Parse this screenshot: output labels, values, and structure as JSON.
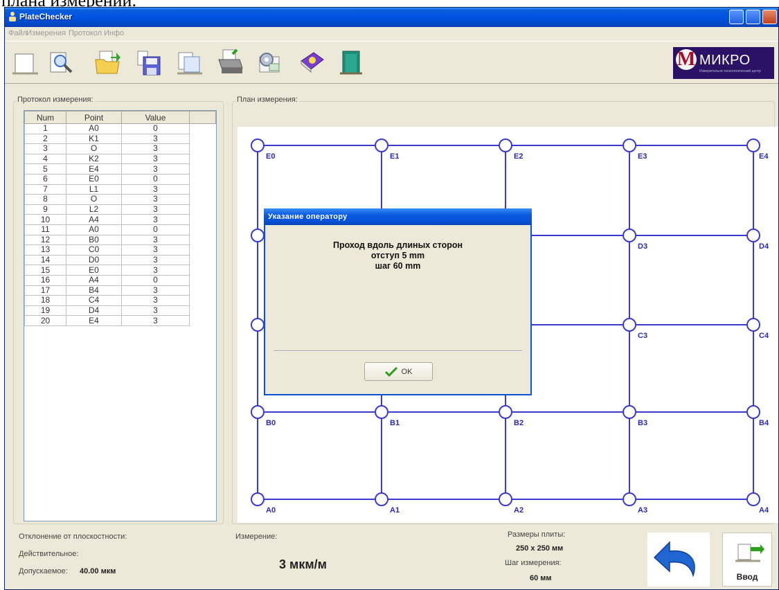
{
  "caption": "плана измерений.",
  "window": {
    "title": "PlateChecker"
  },
  "menu": [
    "Файл",
    "Измерения",
    "Протокол",
    "Инфо"
  ],
  "toolbar": {
    "icons": [
      "new-doc-icon",
      "preview-icon",
      "open-folder-icon",
      "save-icon",
      "copy-icon",
      "print-icon",
      "settings-icon",
      "help-book-icon",
      "exit-door-icon"
    ],
    "logo_brand": "МИКРО",
    "logo_mark": "М",
    "logo_sub": "Измерительно-технологический центр"
  },
  "protocol": {
    "label": "Протокол измерения:",
    "columns": [
      "Num",
      "Point",
      "Value"
    ],
    "rows": [
      [
        "1",
        "A0",
        "0"
      ],
      [
        "2",
        "K1",
        "3"
      ],
      [
        "3",
        "O",
        "3"
      ],
      [
        "4",
        "K2",
        "3"
      ],
      [
        "5",
        "E4",
        "3"
      ],
      [
        "6",
        "E0",
        "0"
      ],
      [
        "7",
        "L1",
        "3"
      ],
      [
        "8",
        "O",
        "3"
      ],
      [
        "9",
        "L2",
        "3"
      ],
      [
        "10",
        "A4",
        "3"
      ],
      [
        "11",
        "A0",
        "0"
      ],
      [
        "12",
        "B0",
        "3"
      ],
      [
        "13",
        "C0",
        "3"
      ],
      [
        "14",
        "D0",
        "3"
      ],
      [
        "15",
        "E0",
        "3"
      ],
      [
        "16",
        "A4",
        "0"
      ],
      [
        "17",
        "B4",
        "3"
      ],
      [
        "18",
        "C4",
        "3"
      ],
      [
        "19",
        "D4",
        "3"
      ],
      [
        "20",
        "E4",
        "3"
      ]
    ]
  },
  "plan": {
    "label": "План измерения:",
    "rows": [
      "E",
      "D",
      "C",
      "B",
      "A"
    ],
    "cols": [
      "0",
      "1",
      "2",
      "3",
      "4"
    ],
    "visible_labels": [
      "E0",
      "E1",
      "E2",
      "E3",
      "E4",
      "D3",
      "D4",
      "C3",
      "C4",
      "B0",
      "B1",
      "B2",
      "B3",
      "B4",
      "A0",
      "A1",
      "A2",
      "A3",
      "A4"
    ]
  },
  "deviation": {
    "title": "Отклонение от плоскостности:",
    "actual_label": "Действительное:",
    "allowed_label": "Допускаемое:",
    "allowed_value": "40.00 мкм"
  },
  "measurement": {
    "label": "Измерение:",
    "value": "3 мкм/м"
  },
  "plate": {
    "size_label": "Размеры плиты:",
    "size_value": "250 x 250 мм",
    "step_label": "Шаг измерения:",
    "step_value": "60 мм"
  },
  "buttons": {
    "enter": "Ввод"
  },
  "dialog": {
    "title": "Указание оператору",
    "line1": "Проход вдоль длиных сторон",
    "line2": "отступ  5 mm",
    "line3": "шаг  60 mm",
    "ok": "OK"
  },
  "colors": {
    "grid": "#3a3ad0",
    "label": "#2a2ab0",
    "title_blue": "#0054e3",
    "accent_check": "#2f9e1e"
  }
}
